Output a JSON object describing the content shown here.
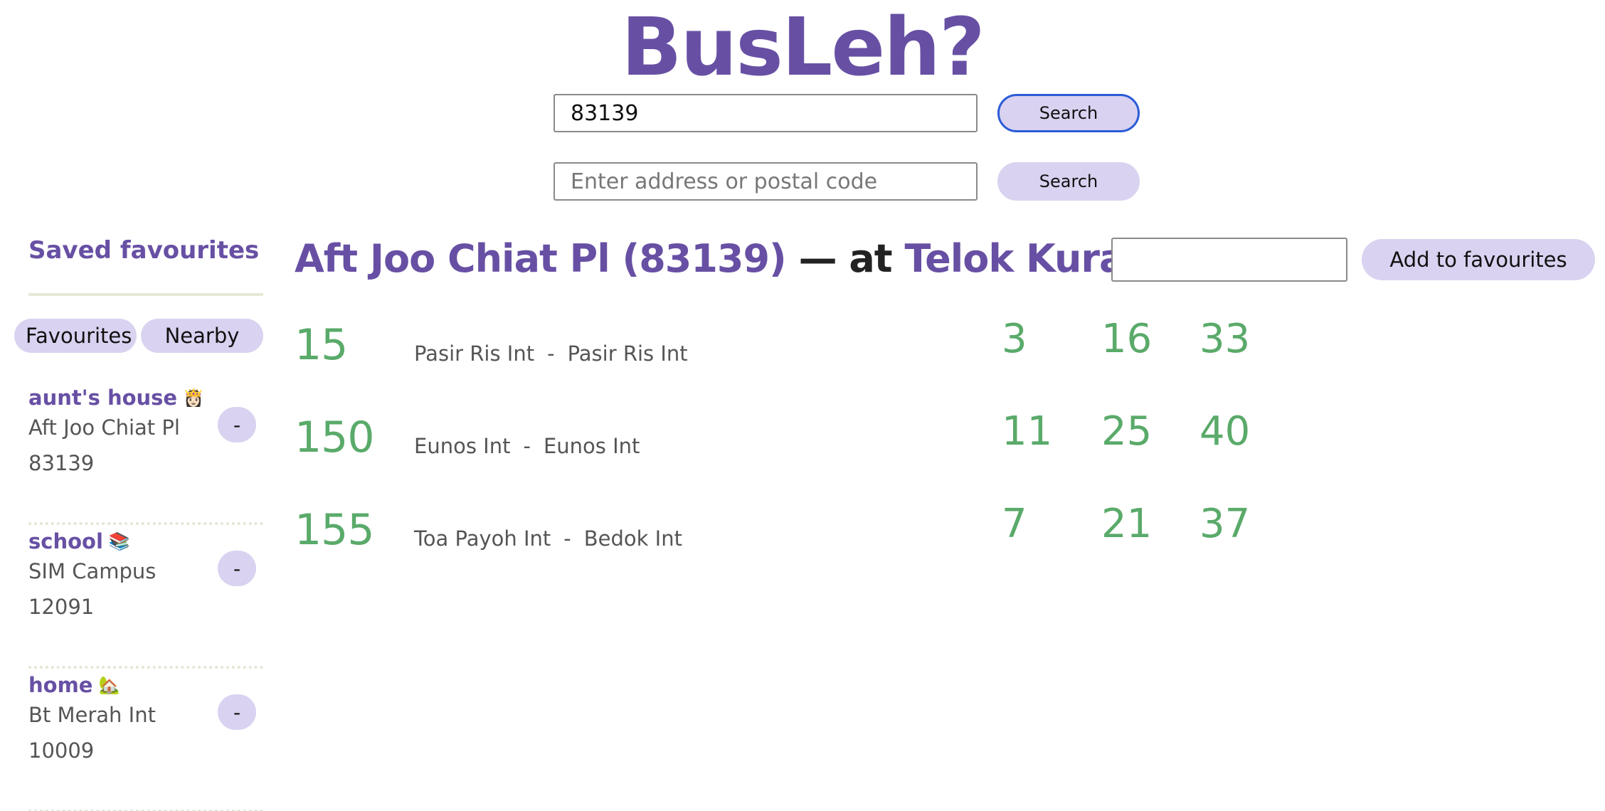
{
  "app": {
    "title": "BusLeh?"
  },
  "search": {
    "stop_code_value": "83139",
    "stop_search_label": "Search",
    "address_placeholder": "Enter address or postal code",
    "address_search_label": "Search"
  },
  "sidebar": {
    "title": "Saved favourites",
    "tabs": [
      {
        "label": "Favourites"
      },
      {
        "label": "Nearby"
      }
    ],
    "favourites": [
      {
        "name": "aunt's house",
        "emoji": "👸🏻",
        "stop": "Aft Joo Chiat Pl",
        "code": "83139",
        "remove_label": "-"
      },
      {
        "name": "school",
        "emoji": "📚",
        "stop": "SIM Campus",
        "code": "12091",
        "remove_label": "-"
      },
      {
        "name": "home",
        "emoji": "🏡",
        "stop": "Bt Merah Int",
        "code": "10009",
        "remove_label": "-"
      }
    ]
  },
  "stop": {
    "name": "Aft Joo Chiat Pl (83139)",
    "separator": "— at",
    "road": "Telok Kurau Rd",
    "fav_name_value": "",
    "add_fav_label": "Add to favourites"
  },
  "buses": [
    {
      "number": "15",
      "origin": "Pasir Ris Int",
      "dash": "-",
      "destination": "Pasir Ris Int",
      "arrivals": [
        "3",
        "16",
        "33"
      ]
    },
    {
      "number": "150",
      "origin": "Eunos Int",
      "dash": "-",
      "destination": "Eunos Int",
      "arrivals": [
        "11",
        "25",
        "40"
      ]
    },
    {
      "number": "155",
      "origin": "Toa Payoh Int",
      "dash": "-",
      "destination": "Bedok Int",
      "arrivals": [
        "7",
        "21",
        "37"
      ]
    }
  ],
  "colors": {
    "accent": "#6750a4",
    "button_bg": "#d9d2f0",
    "arrival_green": "#5aaa6a"
  }
}
